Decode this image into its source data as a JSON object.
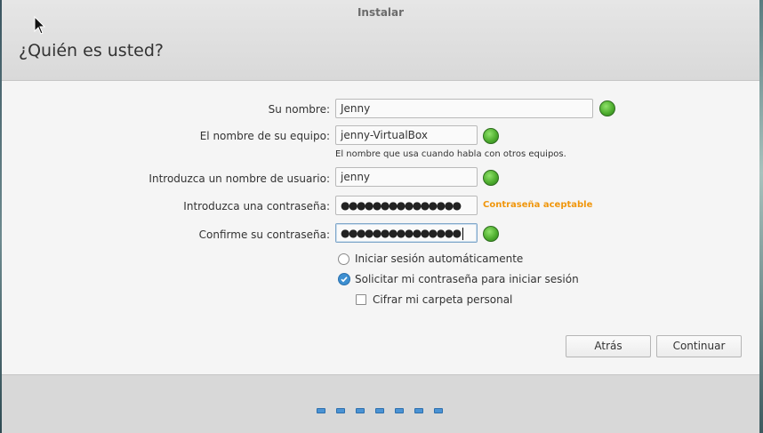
{
  "window": {
    "title": "Instalar"
  },
  "page": {
    "title": "¿Quién es usted?"
  },
  "form": {
    "name_label": "Su nombre:",
    "name_value": "Jenny",
    "computer_label": "El nombre de su equipo:",
    "computer_value": "jenny-VirtualBox",
    "computer_hint": "El nombre que usa cuando habla con otros equipos.",
    "username_label": "Introduzca un nombre de usuario:",
    "username_value": "jenny",
    "password_label": "Introduzca una contraseña:",
    "password_mask": "●●●●●●●●●●●●●●●",
    "password_strength": "Contraseña aceptable",
    "confirm_label": "Confirme su contraseña:",
    "confirm_mask": "●●●●●●●●●●●●●●●"
  },
  "options": {
    "auto_login": {
      "label": "Iniciar sesión automáticamente",
      "selected": false
    },
    "require_password": {
      "label": "Solicitar mi contraseña para iniciar sesión",
      "selected": true
    },
    "encrypt_home": {
      "label": "Cifrar mi carpeta personal",
      "checked": false
    }
  },
  "buttons": {
    "back": "Atrás",
    "continue": "Continuar"
  },
  "colors": {
    "strength_ok": "#f0960c",
    "accent": "#3d8fd1",
    "ok_green": "#4fae2f"
  },
  "progress": {
    "steps": 7
  }
}
